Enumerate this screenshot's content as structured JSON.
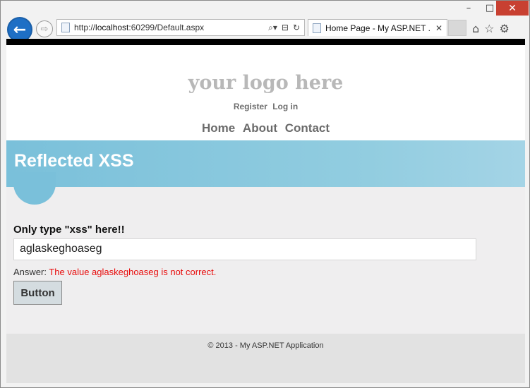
{
  "browser": {
    "window_controls": {
      "minimize": "–",
      "maximize": "□",
      "close": "✕"
    },
    "back_glyph": "←",
    "forward_glyph": "⇨",
    "address": {
      "prefix": "http://",
      "host": "localhost",
      "path": ":60299/Default.aspx"
    },
    "address_tools": {
      "search": "⌕▾",
      "compat": "⊟",
      "refresh": "↻"
    },
    "tab": {
      "title": "Home Page - My ASP.NET ...",
      "close": "✕"
    },
    "tools": {
      "home": "⌂",
      "favorites": "☆",
      "settings": "⚙"
    }
  },
  "site": {
    "logo": "your logo here",
    "login_links": [
      "Register",
      "Log in"
    ],
    "menu": [
      "Home",
      "About",
      "Contact"
    ],
    "heading": "Reflected XSS",
    "form": {
      "prompt": "Only type \"xss\" here!!",
      "input_value": "aglaskeghoaseg",
      "answer_label": "Answer: ",
      "answer_message": "The value aglaskeghoaseg is not correct.",
      "button_label": "Button"
    },
    "footer": "© 2013 - My ASP.NET Application"
  },
  "colors": {
    "accent_blue": "#7ac0da",
    "error_red": "#e80c0c",
    "close_red": "#c84031",
    "back_button_blue": "#1e6fc5"
  }
}
